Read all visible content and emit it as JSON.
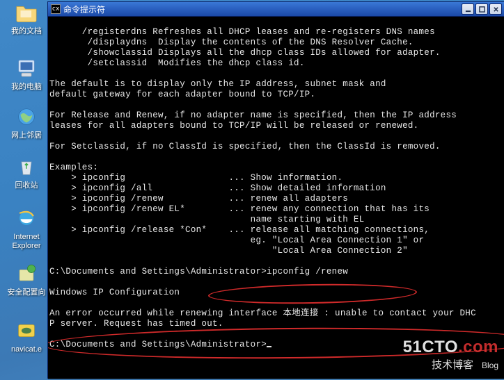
{
  "desktop": {
    "icons": {
      "docs": "我的文档",
      "computer": "我的电脑",
      "network": "网上邻居",
      "recycle": "回收站",
      "ie": "Internet\nExplorer",
      "security": "安全配置向",
      "navicat": "navicat.e"
    }
  },
  "window": {
    "title_prefix": "cx",
    "title": "命令提示符"
  },
  "cmd": {
    "l01": "      /registerdns Refreshes all DHCP leases and re-registers DNS names",
    "l02": "       /displaydns  Display the contents of the DNS Resolver Cache.",
    "l03": "       /showclassid Displays all the dhcp class IDs allowed for adapter.",
    "l04": "       /setclassid  Modifies the dhcp class id.",
    "l05": "",
    "l06": "The default is to display only the IP address, subnet mask and",
    "l07": "default gateway for each adapter bound to TCP/IP.",
    "l08": "",
    "l09": "For Release and Renew, if no adapter name is specified, then the IP address",
    "l10": "leases for all adapters bound to TCP/IP will be released or renewed.",
    "l11": "",
    "l12": "For Setclassid, if no ClassId is specified, then the ClassId is removed.",
    "l13": "",
    "l14": "Examples:",
    "l15": "    > ipconfig                   ... Show information.",
    "l16": "    > ipconfig /all              ... Show detailed information",
    "l17": "    > ipconfig /renew            ... renew all adapters",
    "l18": "    > ipconfig /renew EL*        ... renew any connection that has its",
    "l19": "                                     name starting with EL",
    "l20": "    > ipconfig /release *Con*    ... release all matching connections,",
    "l21": "                                     eg. \"Local Area Connection 1\" or",
    "l22": "                                         \"Local Area Connection 2\"",
    "l23": "",
    "l24": "C:\\Documents and Settings\\Administrator>ipconfig /renew",
    "l25": "",
    "l26": "Windows IP Configuration",
    "l27": "",
    "l28": "An error occurred while renewing interface 本地连接 : unable to contact your DHC",
    "l29": "P server. Request has timed out.",
    "l30": "",
    "l31": "C:\\Documents and Settings\\Administrator>"
  },
  "watermark": {
    "line1a": "51CTO",
    "line1b": ".com",
    "line2": "技术博客",
    "blog": "Blog"
  }
}
